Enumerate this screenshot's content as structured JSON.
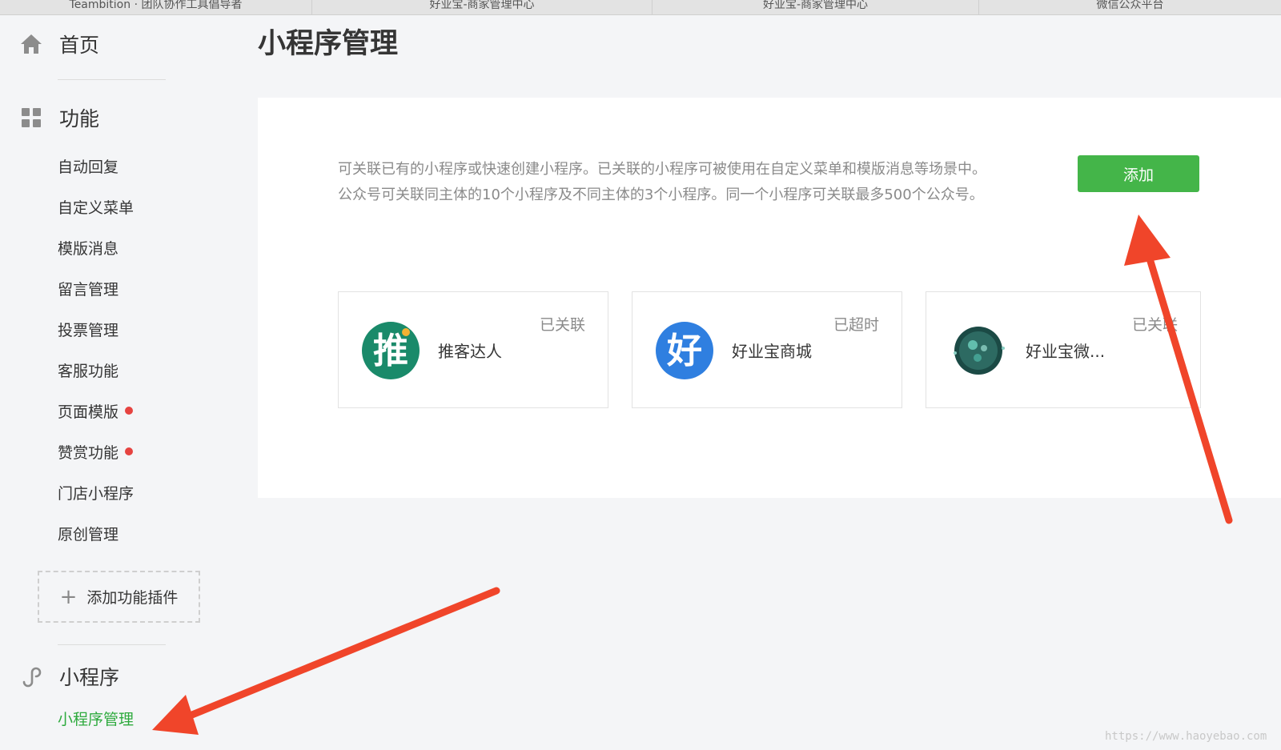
{
  "browser_tabs": [
    "Teambition · 团队协作工具倡导者",
    "好业宝-商家管理中心",
    "好业宝-商家管理中心",
    "微信公众平台"
  ],
  "sidebar": {
    "home_label": "首页",
    "features_label": "功能",
    "feature_items": [
      {
        "label": "自动回复",
        "dot": false
      },
      {
        "label": "自定义菜单",
        "dot": false
      },
      {
        "label": "模版消息",
        "dot": false
      },
      {
        "label": "留言管理",
        "dot": false
      },
      {
        "label": "投票管理",
        "dot": false
      },
      {
        "label": "客服功能",
        "dot": false
      },
      {
        "label": "页面模版",
        "dot": true
      },
      {
        "label": "赞赏功能",
        "dot": true
      },
      {
        "label": "门店小程序",
        "dot": false
      },
      {
        "label": "原创管理",
        "dot": false
      }
    ],
    "add_plugin_label": "添加功能插件",
    "miniprogram_label": "小程序",
    "miniprogram_manage_label": "小程序管理"
  },
  "main": {
    "title": "小程序管理",
    "description_line1": "可关联已有的小程序或快速创建小程序。已关联的小程序可被使用在自定义菜单和模版消息等场景中。",
    "description_line2": "公众号可关联同主体的10个小程序及不同主体的3个小程序。同一个小程序可关联最多500个公众号。",
    "add_button_label": "添加",
    "cards": [
      {
        "name": "推客达人",
        "status": "已关联",
        "logo_char": "推",
        "logo_color": "#1a8a6a"
      },
      {
        "name": "好业宝商城",
        "status": "已超时",
        "logo_char": "好",
        "logo_color": "#2f7fe0"
      },
      {
        "name": "好业宝微...",
        "status": "已关联",
        "logo_char": "",
        "logo_color": "#1b4a45"
      }
    ]
  },
  "colors": {
    "accent_green": "#44b549",
    "active_green": "#2eaa3e",
    "arrow_red": "#f0452a",
    "dot_red": "#e64340"
  },
  "watermark": "https://www.haoyebao.com"
}
